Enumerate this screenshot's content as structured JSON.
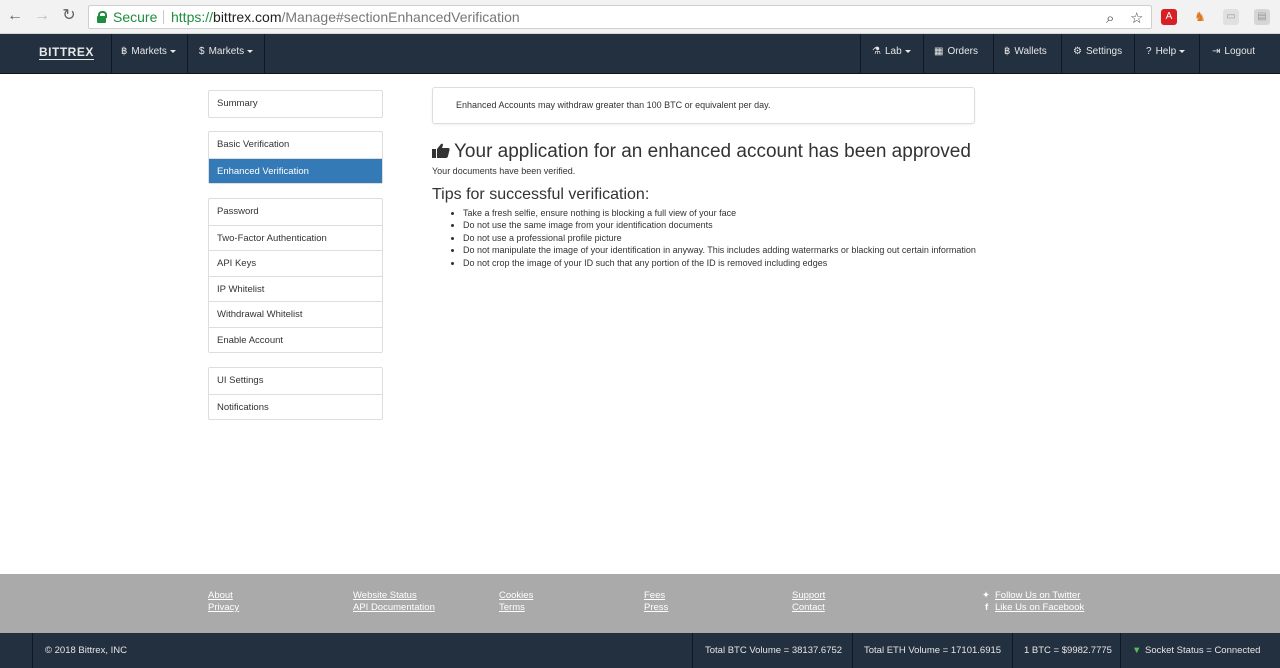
{
  "browser": {
    "secure_label": "Secure",
    "url_scheme": "https://",
    "url_host": "bittrex.com",
    "url_path": "/Manage#sectionEnhancedVerification"
  },
  "nav": {
    "brand": "BITTREX",
    "left": [
      {
        "icon": "bitcoin-icon",
        "glyph": "฿",
        "label": "Markets"
      },
      {
        "icon": "dollar-icon",
        "glyph": "$",
        "label": "Markets"
      }
    ],
    "right": [
      {
        "icon": "flask-icon",
        "glyph": "⚗",
        "label": "Lab",
        "dropdown": true
      },
      {
        "icon": "calendar-icon",
        "glyph": "▦",
        "label": "Orders",
        "dropdown": false
      },
      {
        "icon": "bitcoin-icon",
        "glyph": "฿",
        "label": "Wallets",
        "dropdown": false
      },
      {
        "icon": "gear-icon",
        "glyph": "⚙",
        "label": "Settings",
        "dropdown": false
      },
      {
        "icon": "question-icon",
        "glyph": "?",
        "label": "Help",
        "dropdown": true
      },
      {
        "icon": "logout-icon",
        "glyph": "⇥",
        "label": "Logout",
        "dropdown": false
      }
    ]
  },
  "sidebar": {
    "group1": [
      "Summary"
    ],
    "group2": [
      "Basic Verification",
      "Enhanced Verification"
    ],
    "group3": [
      "Password",
      "Two-Factor Authentication",
      "API Keys",
      "IP Whitelist",
      "Withdrawal Whitelist",
      "Enable Account"
    ],
    "group4": [
      "UI Settings",
      "Notifications"
    ],
    "active": "Enhanced Verification"
  },
  "main": {
    "info": "Enhanced Accounts may withdraw greater than 100 BTC or equivalent per day.",
    "approved_title": "Your application for an enhanced account has been approved",
    "verified_text": "Your documents have been verified.",
    "tips_title": "Tips for successful verification:",
    "tips": [
      "Take a fresh selfie, ensure nothing is blocking a full view of your face",
      "Do not use the same image from your identification documents",
      "Do not use a professional profile picture",
      "Do not manipulate the image of your identification in anyway. This includes adding watermarks or blacking out certain information",
      "Do not crop the image of your ID such that any portion of the ID is removed including edges"
    ]
  },
  "footer": {
    "col1": [
      "About",
      "Privacy"
    ],
    "col2": [
      "Website Status",
      "API Documentation"
    ],
    "col3": [
      "Cookies",
      "Terms"
    ],
    "col4": [
      "Fees",
      "Press"
    ],
    "col5": [
      "Support",
      "Contact"
    ],
    "social": [
      "Follow Us on Twitter",
      "Like Us on Facebook"
    ]
  },
  "status": {
    "copyright": "© 2018 Bittrex, INC",
    "btc_volume": "Total BTC Volume = 38137.6752",
    "eth_volume": "Total ETH Volume = 17101.6915",
    "btc_price": "1 BTC = $9982.7775",
    "socket": "Socket Status = Connected"
  },
  "colors": {
    "navbar": "#233040",
    "active": "#337ab7",
    "footer": "#aaaaaa",
    "secure": "#1e8e3e"
  }
}
